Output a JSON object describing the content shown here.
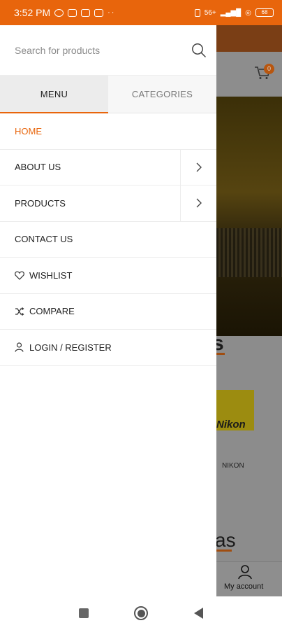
{
  "status_bar": {
    "time": "3:52 PM",
    "network": "56+",
    "battery": "68"
  },
  "search": {
    "placeholder": "Search for products"
  },
  "tabs": [
    {
      "label": "MENU"
    },
    {
      "label": "CATEGORIES"
    }
  ],
  "menu": {
    "items": [
      {
        "label": "HOME"
      },
      {
        "label": "ABOUT US"
      },
      {
        "label": "PRODUCTS"
      },
      {
        "label": "CONTACT US"
      },
      {
        "label": "WISHLIST"
      },
      {
        "label": "COMPARE"
      },
      {
        "label": "LOGIN / REGISTER"
      }
    ]
  },
  "background": {
    "cart_count": "0",
    "brand_label": "NIKON",
    "brand_logo_text": "Nikon",
    "heading_fragment_1": "s",
    "heading_fragment_2": "as",
    "account_label": "My account"
  },
  "colors": {
    "accent": "#e8650c"
  }
}
